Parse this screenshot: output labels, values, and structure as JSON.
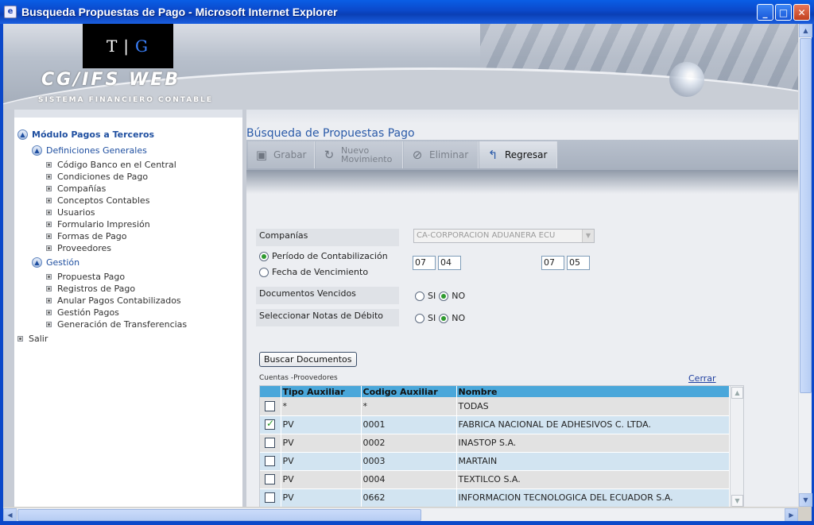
{
  "window": {
    "title": "Busqueda Propuestas de Pago - Microsoft Internet Explorer",
    "minimize": "_",
    "maximize": "□",
    "close": "✕"
  },
  "banner": {
    "logo_left": "T",
    "logo_right": "G",
    "product_name": "CG/IFS  WEB",
    "product_subtitle": "SISTEMA FINANCIERO CONTABLE"
  },
  "nav": {
    "module": "Módulo Pagos a Terceros",
    "group1": {
      "label": "Definiciones Generales",
      "items": [
        "Código Banco en el Central",
        "Condiciones de Pago",
        "Compañías",
        "Conceptos Contables",
        "Usuarios",
        "Formulario Impresión",
        "Formas de Pago",
        "Proveedores"
      ]
    },
    "group2": {
      "label": "Gestión",
      "items": [
        "Propuesta Pago",
        "Registros de Pago",
        "Anular Pagos Contabilizados",
        "Gestión Pagos",
        "Generación de Transferencias"
      ]
    },
    "exit": "Salir"
  },
  "page": {
    "title": "Búsqueda de Propuestas Pago"
  },
  "toolbar": {
    "save": "Grabar",
    "new_line1": "Nuevo",
    "new_line2": "Movimiento",
    "delete": "Eliminar",
    "back": "Regresar"
  },
  "form": {
    "companies_label": "Companías",
    "companies_value": "CA-CORPORACION ADUANERA ECU",
    "period_option": "Período de Contabilización",
    "due_option": "Fecha de Vencimiento",
    "from_year": "07",
    "from_month": "04",
    "to_year": "07",
    "to_month": "05",
    "expired_label": "Documentos Vencidos",
    "debit_label": "Seleccionar Notas de Débito",
    "yes": "SI",
    "no": "NO",
    "search_button": "Buscar Documentos"
  },
  "grid": {
    "title": "Cuentas -Proovedores",
    "close_link": "Cerrar",
    "columns": [
      "Tipo Auxiliar",
      "Codigo Auxiliar",
      "Nombre"
    ],
    "rows": [
      {
        "checked": false,
        "tipo": "*",
        "codigo": "*",
        "nombre": "TODAS"
      },
      {
        "checked": true,
        "tipo": "PV",
        "codigo": "0001",
        "nombre": "FABRICA NACIONAL DE ADHESIVOS C. LTDA."
      },
      {
        "checked": false,
        "tipo": "PV",
        "codigo": "0002",
        "nombre": "INASTOP S.A."
      },
      {
        "checked": false,
        "tipo": "PV",
        "codigo": "0003",
        "nombre": "MARTAIN"
      },
      {
        "checked": false,
        "tipo": "PV",
        "codigo": "0004",
        "nombre": "TEXTILCO S.A."
      },
      {
        "checked": false,
        "tipo": "PV",
        "codigo": "0662",
        "nombre": "INFORMACION TECNOLOGICA DEL ECUADOR S.A."
      }
    ]
  }
}
